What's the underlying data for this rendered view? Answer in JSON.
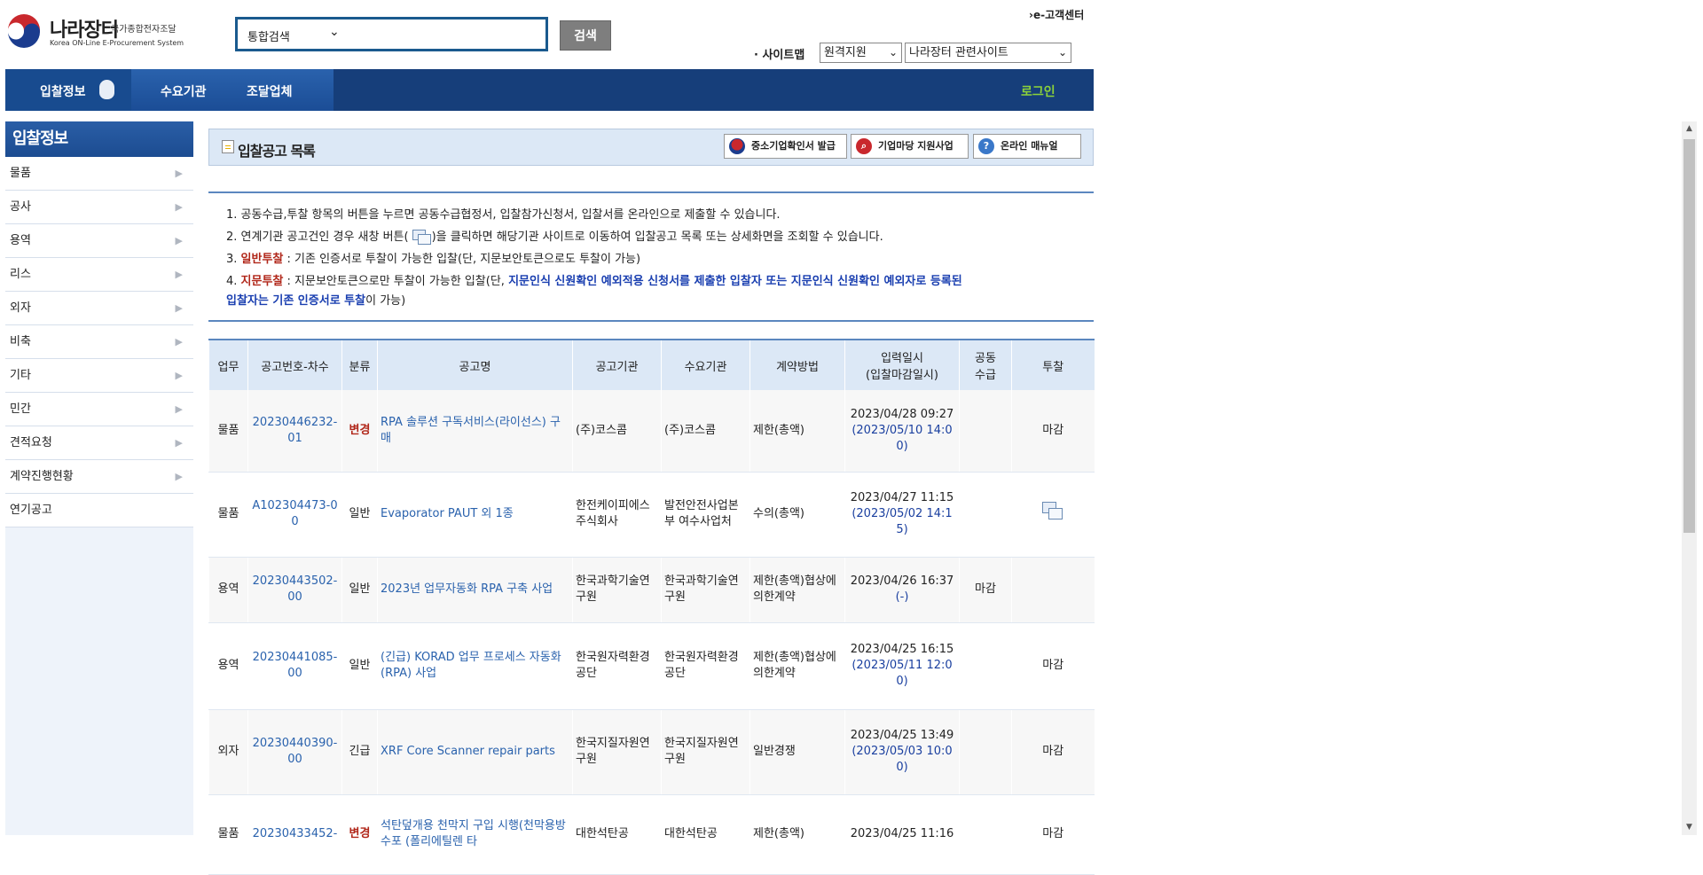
{
  "header": {
    "logo_title": "나라장터",
    "logo_subtitle": "국가종합전자조달",
    "logo_english": "Korea ON-Line E-Procurement System",
    "search_scope": "통합검색",
    "search_button": "검색",
    "customer_center": "e-고객센터",
    "sitemap_label": "· 사이트맵",
    "select_remote": "원격지원",
    "select_related": "나라장터 관련사이트"
  },
  "nav": {
    "items": [
      "입찰정보",
      "수요기관",
      "조달업체"
    ],
    "login": "로그인"
  },
  "sidebar": {
    "title": "입찰정보",
    "items": [
      "물품",
      "공사",
      "용역",
      "리스",
      "외자",
      "비축",
      "기타",
      "민간",
      "견적요청",
      "계약진행현황",
      "연기공고"
    ]
  },
  "content": {
    "page_title": "입찰공고 목록",
    "buttons": [
      "중소기업확인서 발급",
      "기업마당 지원사업",
      "온라인 매뉴얼"
    ],
    "notice": {
      "n1": "1. 공동수급,투찰 항목의 버튼을 누르면 공동수급협정서, 입찰참가신청서, 입찰서를 온라인으로 제출할 수 있습니다.",
      "n2_a": "2. 연계기관 공고건인 경우 새창 버튼(",
      "n2_b": ")을 클릭하면 해당기관 사이트로 이동하여 입찰공고 목록 또는 상세화면을 조회할 수 있습니다.",
      "n3_prefix": "3. ",
      "n3_red": "일반투찰",
      "n3_rest": " : 기존 인증서로 투찰이 가능한 입찰(단, 지문보안토큰으로도 투찰이 가능)",
      "n4_prefix": "4. ",
      "n4_red": "지문투찰",
      "n4_rest": " : 지문보안토큰으로만 투찰이 가능한 입찰(단, ",
      "n4_blue1": "지문인식 신원확인 예외적용 신청서를 제출한 입찰자 또는 지문인식 신원확인 예외자로 등록된",
      "n4_blue2": "입찰자는 기존 인증서로 투찰",
      "n4_end": "이 가능)"
    }
  },
  "table": {
    "headers": [
      "업무",
      "공고번호-차수",
      "분류",
      "공고명",
      "공고기관",
      "수요기관",
      "계약방법",
      "입력일시\n(입찰마감일시)",
      "공동\n수급",
      "투찰"
    ],
    "rows": [
      {
        "work": "물품",
        "no": "20230446232-01",
        "kind": "변경",
        "name": "RPA 솔루션 구독서비스(라이선스) 구매",
        "agency": "(주)코스콤",
        "demand": "(주)코스콤",
        "method": "제한(총액)",
        "date": "2023/04/28 09:27",
        "deadline": "(2023/05/10 14:00)",
        "joint": "",
        "bid": "마감"
      },
      {
        "work": "물품",
        "no": "A102304473-00",
        "kind": "일반",
        "name": "Evaporator PAUT 외 1종",
        "agency": "한전케이피에스주식회사",
        "demand": "발전안전사업본부 여수사업처",
        "method": "수의(총액)",
        "date": "2023/04/27 11:15",
        "deadline": "(2023/05/02 14:15)",
        "joint": "",
        "bid": ""
      },
      {
        "work": "용역",
        "no": "20230443502-00",
        "kind": "일반",
        "name": "2023년 업무자동화 RPA 구축 사업",
        "agency": "한국과학기술연구원",
        "demand": "한국과학기술연구원",
        "method": "제한(총액)협상에의한계약",
        "date": "2023/04/26 16:37",
        "deadline": "(-)",
        "joint": "마감",
        "bid": ""
      },
      {
        "work": "용역",
        "no": "20230441085-00",
        "kind": "일반",
        "name": "(긴급) KORAD 업무 프로세스 자동화(RPA) 사업",
        "agency": "한국원자력환경공단",
        "demand": "한국원자력환경공단",
        "method": "제한(총액)협상에의한계약",
        "date": "2023/04/25 16:15",
        "deadline": "(2023/05/11 12:00)",
        "joint": "",
        "bid": "마감"
      },
      {
        "work": "외자",
        "no": "20230440390-00",
        "kind": "긴급",
        "name": "XRF Core Scanner repair parts",
        "agency": "한국지질자원연구원",
        "demand": "한국지질자원연구원",
        "method": "일반경쟁",
        "date": "2023/04/25 13:49",
        "deadline": "(2023/05/03 10:00)",
        "joint": "",
        "bid": "마감"
      },
      {
        "work": "물품",
        "no": "20230433452-",
        "kind": "변경",
        "name": "석탄덮개용 천막지 구입 시행(천막용방수포 (폴리에틸렌 타",
        "agency": "대한석탄공",
        "demand": "대한석탄공",
        "method": "제한(총액)",
        "date": "2023/04/25 11:16",
        "deadline": "",
        "joint": "",
        "bid": "마감"
      }
    ]
  },
  "colors": {
    "nav_blue": "#1b4d96",
    "login_green": "#8cd23a",
    "link_blue": "#2a62ad",
    "alert_red": "#b1271a"
  }
}
